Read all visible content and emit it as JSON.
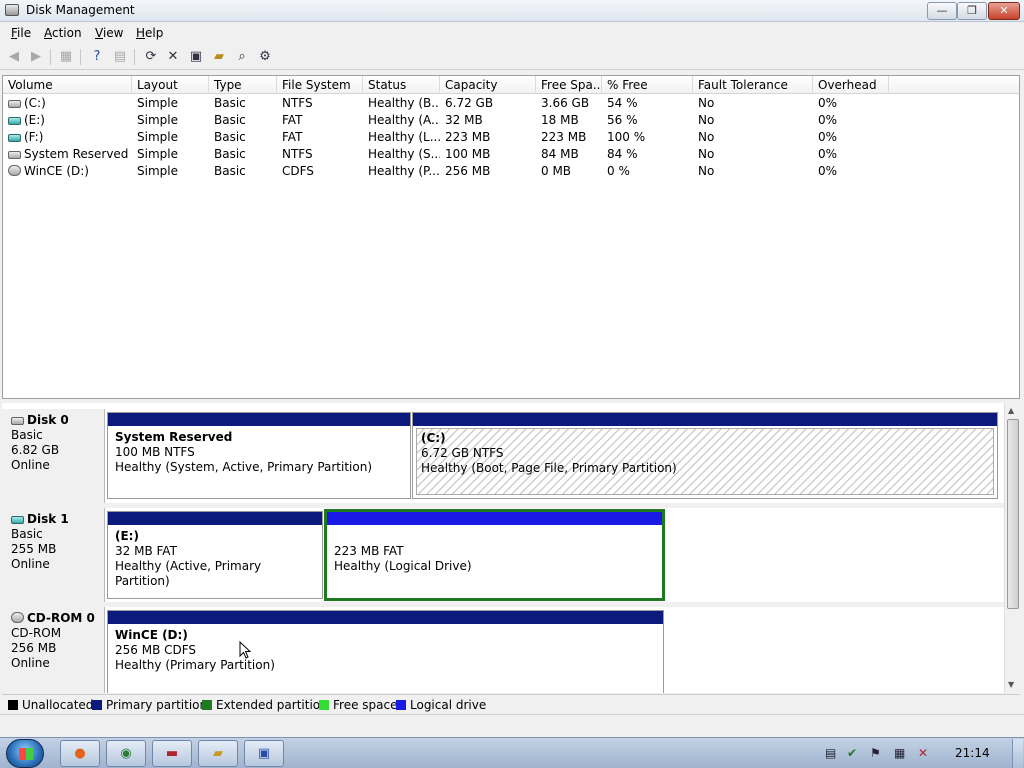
{
  "window": {
    "title": "Disk Management",
    "min": "—",
    "max": "❐",
    "close": "✕"
  },
  "menu": [
    {
      "u": "F",
      "rest": "ile"
    },
    {
      "u": "A",
      "rest": "ction"
    },
    {
      "u": "V",
      "rest": "iew"
    },
    {
      "u": "H",
      "rest": "elp"
    }
  ],
  "columns": [
    "Volume",
    "Layout",
    "Type",
    "File System",
    "Status",
    "Capacity",
    "Free Spa...",
    "% Free",
    "Fault Tolerance",
    "Overhead"
  ],
  "volumes": [
    [
      "(C:)",
      "Simple",
      "Basic",
      "NTFS",
      "Healthy (B...",
      "6.72 GB",
      "3.66 GB",
      "54 %",
      "No",
      "0%"
    ],
    [
      "(E:)",
      "Simple",
      "Basic",
      "FAT",
      "Healthy (A...",
      "32 MB",
      "18 MB",
      "56 %",
      "No",
      "0%"
    ],
    [
      "(F:)",
      "Simple",
      "Basic",
      "FAT",
      "Healthy (L...",
      "223 MB",
      "223 MB",
      "100 %",
      "No",
      "0%"
    ],
    [
      "System Reserved",
      "Simple",
      "Basic",
      "NTFS",
      "Healthy (S...",
      "100 MB",
      "84 MB",
      "84 %",
      "No",
      "0%"
    ],
    [
      "WinCE (D:)",
      "Simple",
      "Basic",
      "CDFS",
      "Healthy (P...",
      "256 MB",
      "0 MB",
      "0 %",
      "No",
      "0%"
    ]
  ],
  "disks": {
    "disk0": {
      "name": "Disk 0",
      "type": "Basic",
      "size": "6.82 GB",
      "state": "Online",
      "p1": {
        "name": "System Reserved",
        "size": "100 MB NTFS",
        "status": "Healthy (System, Active, Primary Partition)"
      },
      "p2": {
        "name": "(C:)",
        "size": "6.72 GB NTFS",
        "status": "Healthy (Boot, Page File, Primary Partition)"
      }
    },
    "disk1": {
      "name": "Disk 1",
      "type": "Basic",
      "size": "255 MB",
      "state": "Online",
      "p1": {
        "name": "(E:)",
        "size": "32 MB FAT",
        "status": "Healthy (Active, Primary Partition)"
      },
      "p2": {
        "size": "223 MB FAT",
        "status": "Healthy (Logical Drive)"
      }
    },
    "cdrom0": {
      "name": "CD-ROM 0",
      "type": "CD-ROM",
      "size": "256 MB",
      "state": "Online",
      "p1": {
        "name": "WinCE  (D:)",
        "size": "256 MB CDFS",
        "status": "Healthy (Primary Partition)"
      }
    }
  },
  "legend": [
    {
      "label": "Unallocated",
      "color": "#000000"
    },
    {
      "label": "Primary partition",
      "color": "#0b1a7c"
    },
    {
      "label": "Extended partition",
      "color": "#1f7a1f"
    },
    {
      "label": "Free space",
      "color": "#33dd33"
    },
    {
      "label": "Logical drive",
      "color": "#1a1ae6"
    }
  ],
  "taskbar": {
    "clock": "21:14"
  }
}
